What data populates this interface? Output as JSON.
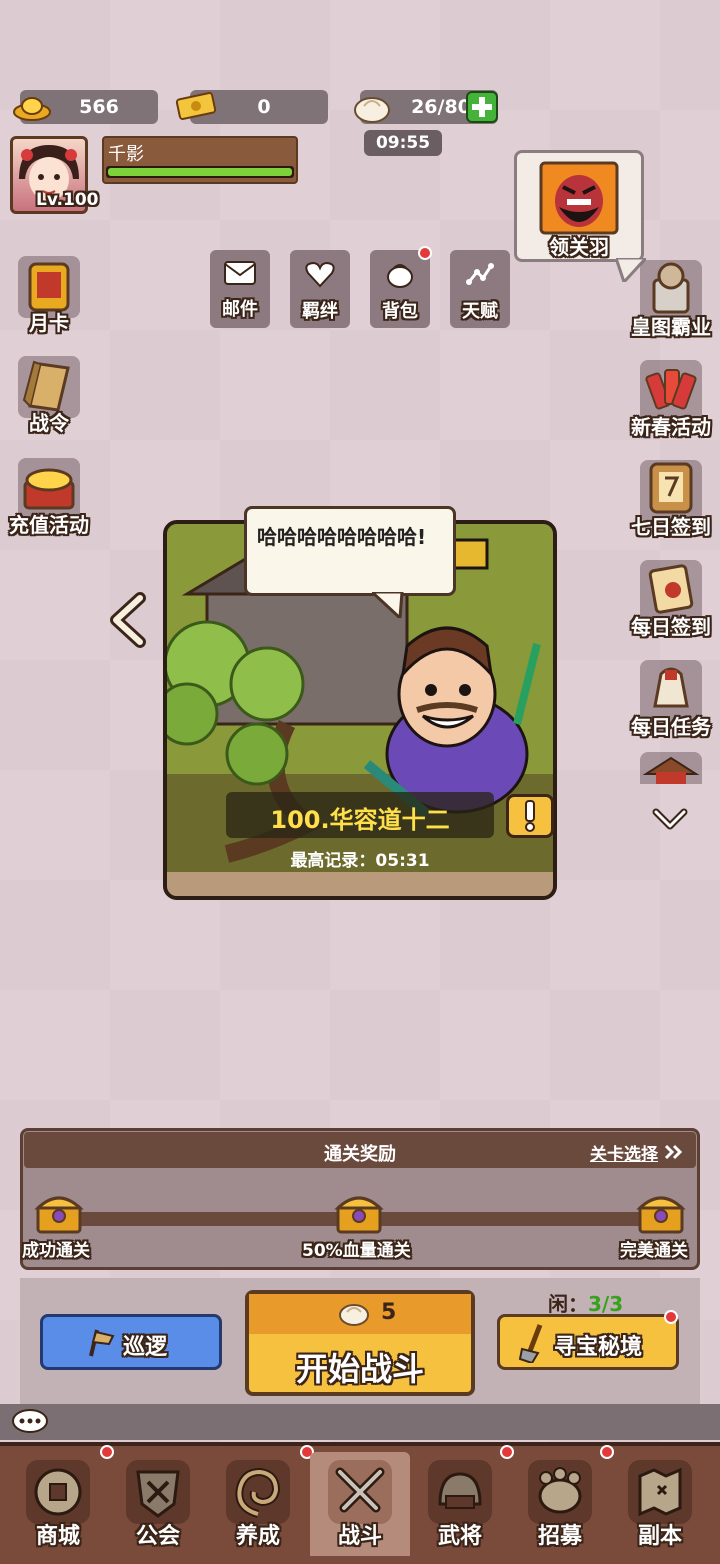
{
  "resources": {
    "gold": "566",
    "ticket": "0",
    "stamina": "26/80"
  },
  "player": {
    "name": "千影",
    "level": "Lv.100",
    "hp_fraction": 1.0
  },
  "timer": "09:55",
  "featured_hero": {
    "name": "领关羽"
  },
  "top_buttons": [
    {
      "label": "邮件",
      "icon": "mail-icon"
    },
    {
      "label": "羁绊",
      "icon": "heart-icon"
    },
    {
      "label": "背包",
      "icon": "bag-icon",
      "badge": true
    },
    {
      "label": "天赋",
      "icon": "talent-icon"
    }
  ],
  "left_menu": [
    {
      "label": "月卡",
      "icon": "month-card-icon"
    },
    {
      "label": "战令",
      "icon": "battle-pass-icon"
    },
    {
      "label": "充值活动",
      "icon": "recharge-icon"
    }
  ],
  "right_menu": [
    {
      "label": "皇图霸业",
      "icon": "emperor-icon"
    },
    {
      "label": "新春活动",
      "icon": "firecracker-icon"
    },
    {
      "label": "七日签到",
      "icon": "seven-day-icon"
    },
    {
      "label": "每日签到",
      "icon": "daily-checkin-icon"
    },
    {
      "label": "每日任务",
      "icon": "daily-task-icon"
    }
  ],
  "stage": {
    "speech": "哈哈哈哈哈哈哈哈!",
    "name": "100.华容道十二",
    "best_record": "最高记录：05:31"
  },
  "rewards": {
    "title": "通关奖励",
    "select": "关卡选择",
    "milestones": [
      "成功通关",
      "50%血量通关",
      "完美通关"
    ]
  },
  "actions": {
    "patrol": "巡逻",
    "start_cost": "5",
    "start": "开始战斗",
    "idle_label": "闲：",
    "idle_value": "3/3",
    "treasure": "寻宝秘境"
  },
  "tabs": [
    {
      "label": "商城",
      "icon": "shop-icon",
      "badge": true
    },
    {
      "label": "公会",
      "icon": "guild-icon",
      "badge": false
    },
    {
      "label": "养成",
      "icon": "growth-icon",
      "badge": true
    },
    {
      "label": "战斗",
      "icon": "battle-icon",
      "badge": false,
      "active": true
    },
    {
      "label": "武将",
      "icon": "general-icon",
      "badge": true
    },
    {
      "label": "招募",
      "icon": "recruit-icon",
      "badge": true
    },
    {
      "label": "副本",
      "icon": "dungeon-icon",
      "badge": false
    }
  ],
  "colors": {
    "accent": "#f5c13e",
    "patrol_blue": "#5a8de8",
    "badge_red": "#e23a3a",
    "hp_green": "#7dd23a"
  }
}
